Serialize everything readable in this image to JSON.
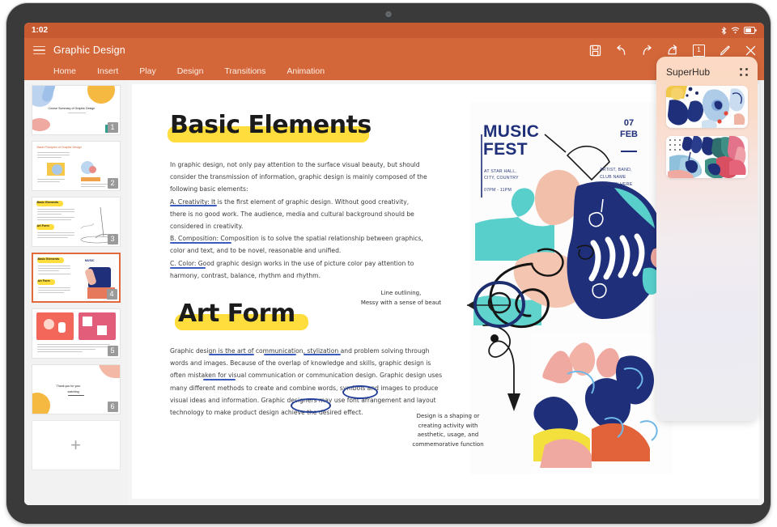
{
  "status_bar": {
    "time": "1:02",
    "icons": [
      "bluetooth-icon",
      "wifi-icon",
      "battery-icon"
    ]
  },
  "app_header": {
    "menu_icon": "hamburger-menu-icon",
    "document_title": "Graphic Design",
    "tools": [
      {
        "name": "save-icon",
        "label": "Save"
      },
      {
        "name": "undo-icon",
        "label": "Undo"
      },
      {
        "name": "redo-icon",
        "label": "Redo"
      },
      {
        "name": "share-icon",
        "label": "Share"
      },
      {
        "name": "slide-number-icon",
        "label": "1"
      },
      {
        "name": "pen-icon",
        "label": "Pen"
      },
      {
        "name": "close-icon",
        "label": "Close"
      }
    ],
    "slide_indicator": "1"
  },
  "ribbon": {
    "tabs": [
      {
        "label": "Home",
        "active": true
      },
      {
        "label": "Insert",
        "active": false
      },
      {
        "label": "Play",
        "active": false
      },
      {
        "label": "Design",
        "active": false
      },
      {
        "label": "Transitions",
        "active": false
      },
      {
        "label": "Animation",
        "active": false
      }
    ]
  },
  "slide_panel": {
    "add_slide_label": "+",
    "slides": [
      {
        "number": "1",
        "title": "Course Summary of Graphic Design",
        "selected": false
      },
      {
        "number": "2",
        "title": "Basic Principles of Graphic Design",
        "selected": false
      },
      {
        "number": "3",
        "title": "Basic Elements",
        "subtitle": "Art Form",
        "selected": false
      },
      {
        "number": "4",
        "title": "Basic Elements",
        "subtitle": "Art Form",
        "selected": true
      },
      {
        "number": "5",
        "title": "",
        "selected": false
      },
      {
        "number": "6",
        "title": "Thank you for your watching",
        "selected": false
      }
    ]
  },
  "slide": {
    "headings": [
      {
        "text": "Basic Elements"
      },
      {
        "text": "Art Form"
      }
    ],
    "basic_elements_body": [
      "In graphic design, not only pay attention to the surface visual beauty, but should",
      "consider the transmission of information, graphic design is mainly composed of the",
      "following basic elements:",
      "A. Creativity: It is the first element of graphic design. Without good creativity,",
      "there is no good work. The audience, media and cultural background should be",
      "considered in creativity.",
      "B. Composition: Composition is to solve the spatial relationship between graphics,",
      "color and text, and to be novel, reasonable and unified.",
      "C. Color: Good graphic design works in the use of picture color pay attention to",
      "harmony, contrast, balance, rhythm and rhythm."
    ],
    "art_form_body": [
      "Graphic design is the art of communication, stylization and problem solving through",
      "words and images. Because of the overlap of knowledge and skills, graphic design is",
      "often mistaken for visual communication or communication design. Graphic design uses",
      "many different methods to create and combine words, symbols and images to produce",
      "visual ideas and information. Graphic designers may use font arrangement and layout",
      "technology to make product design achieve the desired effect."
    ],
    "annotations": [
      {
        "lines": [
          "Line outlining,",
          "Messy with a sense of beaut"
        ]
      },
      {
        "lines": [
          "Design is a shaping or",
          "creating activity with",
          "aesthetic, usage, and",
          "commemorative function"
        ]
      }
    ],
    "poster": {
      "title_line1": "MUSIC",
      "title_line2": "FEST",
      "venue_line1": "AT STAR HALL,",
      "venue_line2": "CITY, COUNTRY",
      "time": "07PM - 11PM",
      "date_day": "07",
      "date_month": "FEB",
      "credits_line1": "ARTIST, BAND,",
      "credits_line2": "CLUB NAME",
      "credits_line3": "GOES IN HERE"
    },
    "highlight_color": "#ffdd3c",
    "annotation_ink_color": "#24409a"
  },
  "superhub": {
    "title": "SuperHub",
    "grid_icon": "grid-dots-icon",
    "cards": [
      {
        "name": "thumbnail-1"
      },
      {
        "name": "thumbnail-2"
      }
    ]
  }
}
